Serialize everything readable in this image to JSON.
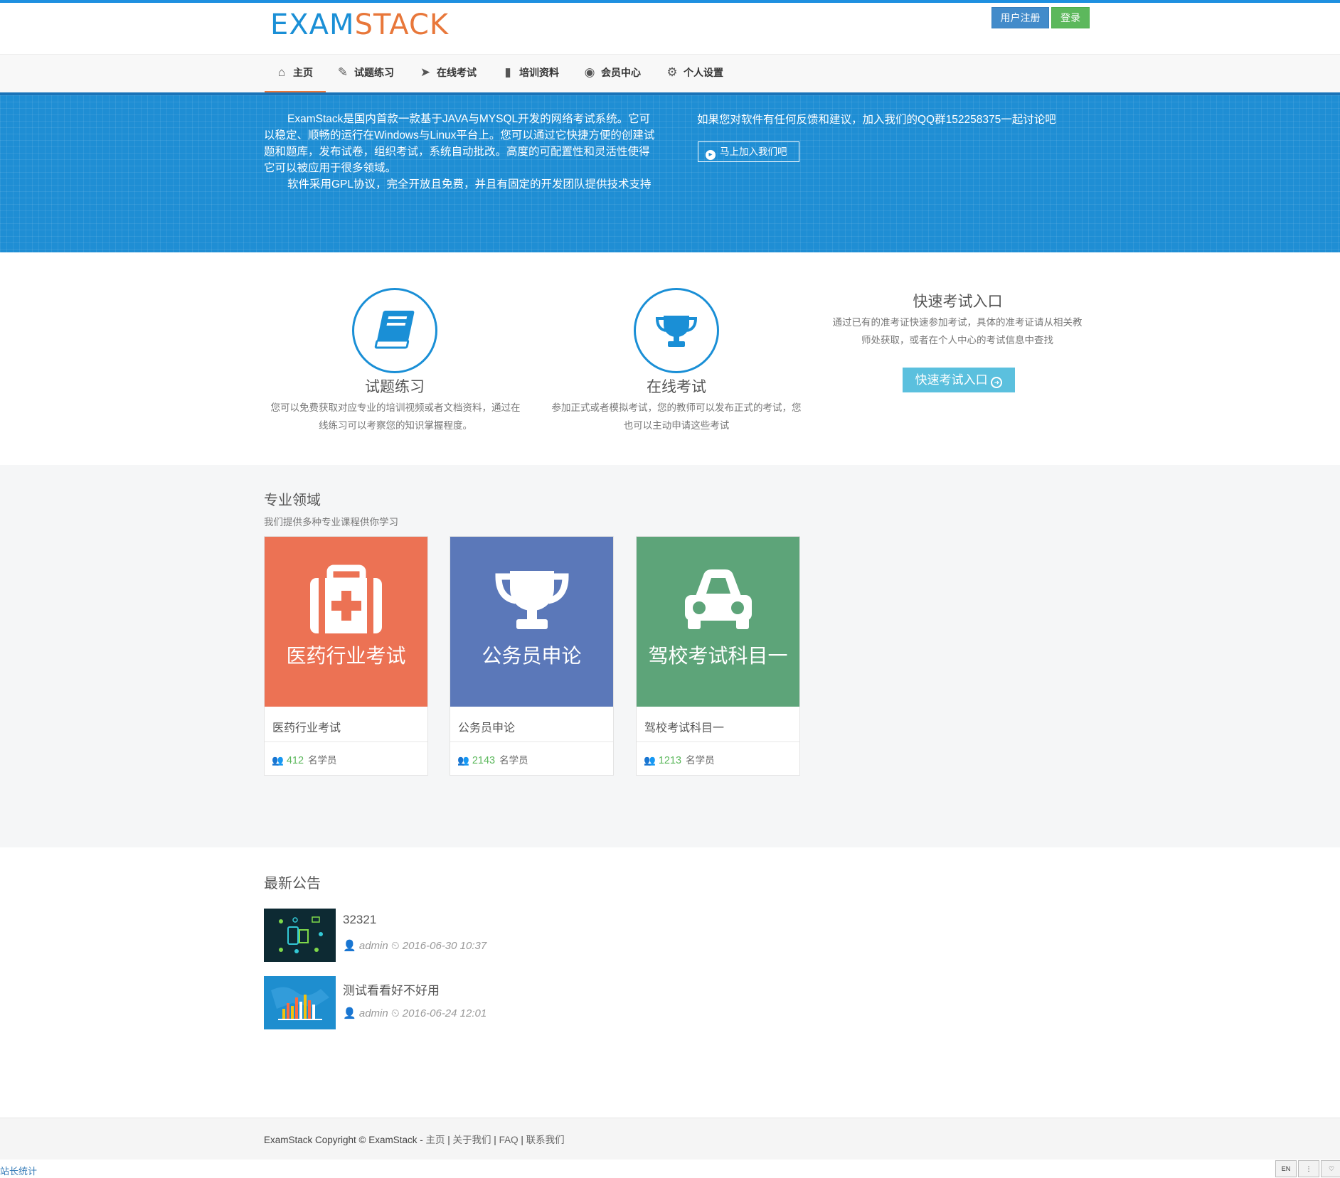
{
  "header": {
    "logo_part1": "EXAM",
    "logo_part2": "STACK",
    "register_label": "用户注册",
    "login_label": "登录"
  },
  "nav": {
    "items": [
      {
        "label": "主页",
        "icon": "home-icon"
      },
      {
        "label": "试题练习",
        "icon": "edit-icon"
      },
      {
        "label": "在线考试",
        "icon": "paper-plane-icon"
      },
      {
        "label": "培训资料",
        "icon": "book-icon"
      },
      {
        "label": "会员中心",
        "icon": "dashboard-icon"
      },
      {
        "label": "个人设置",
        "icon": "gears-icon"
      }
    ],
    "active": "主页"
  },
  "hero": {
    "para1": "ExamStack是国内首款一款基于JAVA与MYSQL开发的网络考试系统。它可以稳定、顺畅的运行在Windows与Linux平台上。您可以通过它快捷方便的创建试题和题库，发布试卷，组织考试，系统自动批改。高度的可配置性和灵活性使得它可以被应用于很多领域。",
    "para2": "软件采用GPL协议，完全开放且免费，并且有固定的开发团队提供技术支持",
    "feedback": "如果您对软件有任何反馈和建议，加入我们的QQ群152258375一起讨论吧",
    "join_label": "马上加入我们吧"
  },
  "features": [
    {
      "title": "试题练习",
      "icon": "book-icon",
      "desc_line1": "您可以免费获取对应专业的培训视频或者文档资料，通过在",
      "desc_line2": "线练习可以考察您的知识掌握程度。"
    },
    {
      "title": "在线考试",
      "icon": "trophy-icon",
      "desc_line1": "参加正式或者模拟考试，您的教师可以发布正式的考试，您",
      "desc_line2": "也可以主动申请这些考试"
    }
  ],
  "quick": {
    "title": "快速考试入口",
    "desc_line1": "通过已有的准考证快速参加考试，具体的准考证请从相关教",
    "desc_line2": "师处获取，或者在个人中心的考试信息中查找",
    "button": "快速考试入口"
  },
  "fields": {
    "title": "专业领域",
    "subtitle": "我们提供多种专业课程供你学习",
    "cards": [
      {
        "caption": "医药行业考试",
        "name": "医药行业考试",
        "count": "412",
        "unit": "名学员",
        "color": "#ec7254",
        "icon": "medkit-icon"
      },
      {
        "caption": "公务员申论",
        "name": "公务员申论",
        "count": "2143",
        "unit": "名学员",
        "color": "#5b78b9",
        "icon": "trophy-icon"
      },
      {
        "caption": "驾校考试科目一",
        "name": "驾校考试科目一",
        "count": "1213",
        "unit": "名学员",
        "color": "#5da479",
        "icon": "car-icon"
      }
    ]
  },
  "news": {
    "title": "最新公告",
    "items": [
      {
        "title": "32321",
        "author": "admin",
        "date": "2016-06-30 10:37"
      },
      {
        "title": "测试看看好不好用",
        "author": "admin",
        "date": "2016-06-24 12:01"
      }
    ]
  },
  "footer": {
    "copyright": "ExamStack Copyright © ExamStack - ",
    "links": [
      "主页",
      "关于我们",
      "FAQ",
      "联系我们"
    ],
    "separator": " | "
  },
  "stat_link": "站长统计",
  "corner_tools": [
    "EN",
    "⋮",
    "♡"
  ]
}
